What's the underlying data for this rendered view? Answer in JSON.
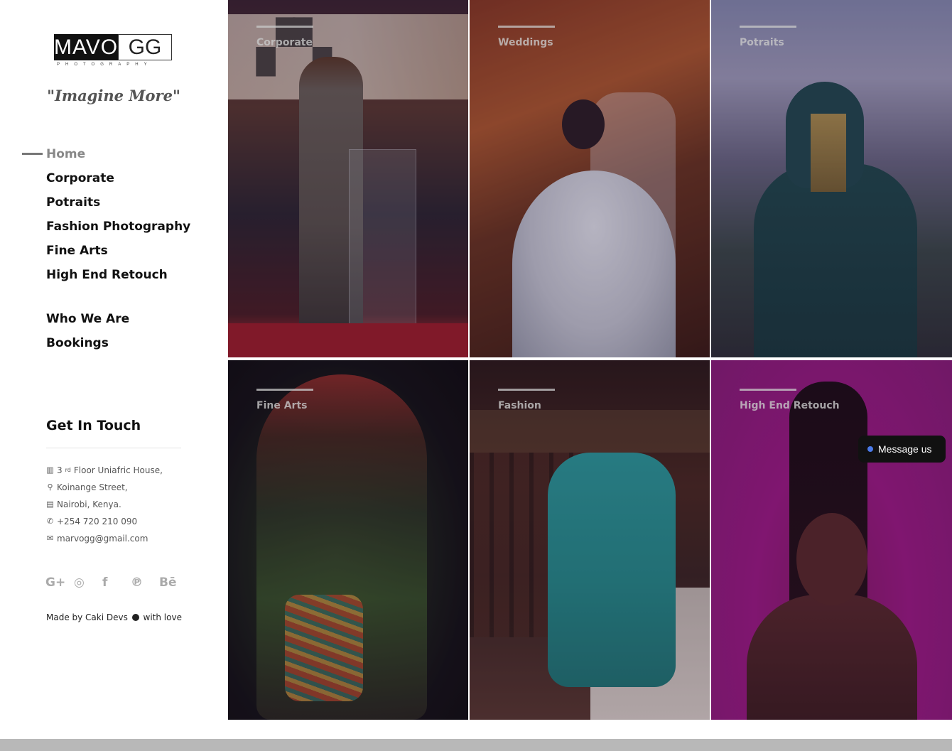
{
  "brand": {
    "logo_left": "MAVO",
    "logo_right": "GG",
    "logo_sub": "PHOTOGRAPHY",
    "tagline": "\"Imagine More\""
  },
  "nav": {
    "items": [
      "Home",
      "Corporate",
      "Potraits",
      "Fashion Photography",
      "Fine Arts",
      "High End Retouch"
    ],
    "secondary": [
      "Who We Are",
      "Bookings"
    ],
    "active": "Home"
  },
  "contact": {
    "title": "Get In Touch",
    "floor_prefix": "3",
    "floor_sup": "rd",
    "floor_rest": "Floor Uniafric House,",
    "street": "Koinange Street,",
    "city": "Nairobi, Kenya.",
    "phone": "+254 720 210 090",
    "email": "marvogg@gmail.com"
  },
  "social": {
    "google": "G+",
    "instagram": "◎",
    "facebook": "f",
    "pinterest": "℗",
    "behance": "Bē"
  },
  "credit": {
    "prefix": "Made by Caki Devs",
    "suffix": "with love"
  },
  "gallery": {
    "tiles": [
      "Corporate",
      "Weddings",
      "Potraits",
      "Fine Arts",
      "Fashion",
      "High End Retouch"
    ]
  },
  "message_button": "Message us",
  "colors": {
    "accent_dark": "#111111",
    "nav_active": "#888888",
    "footer": "#b8b8b8",
    "messenger_dot": "#4a7ae8"
  }
}
